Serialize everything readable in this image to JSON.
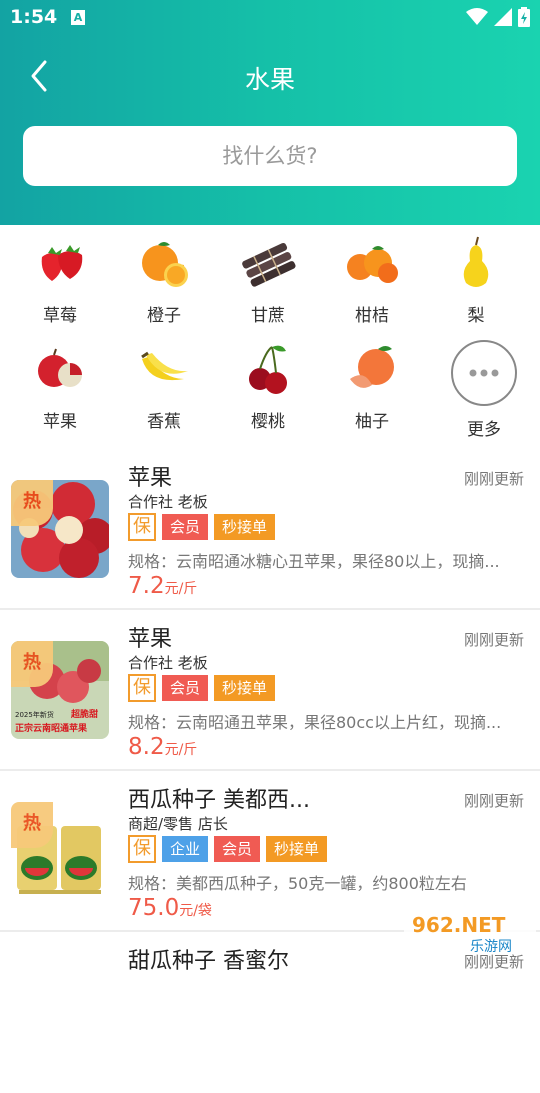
{
  "status": {
    "time": "1:54",
    "notif_letter": "A"
  },
  "header": {
    "title": "水果",
    "search_placeholder": "找什么货?"
  },
  "categories": [
    {
      "label": "草莓",
      "icon": "strawberry-icon"
    },
    {
      "label": "橙子",
      "icon": "orange-icon"
    },
    {
      "label": "甘蔗",
      "icon": "sugarcane-icon"
    },
    {
      "label": "柑桔",
      "icon": "tangerine-icon"
    },
    {
      "label": "梨",
      "icon": "pear-icon"
    },
    {
      "label": "苹果",
      "icon": "apple-icon"
    },
    {
      "label": "香蕉",
      "icon": "banana-icon"
    },
    {
      "label": "樱桃",
      "icon": "cherry-icon"
    },
    {
      "label": "柚子",
      "icon": "grapefruit-icon"
    },
    {
      "label": "更多",
      "icon": "more-icon"
    }
  ],
  "items": [
    {
      "title": "苹果",
      "time": "刚刚更新",
      "seller": "合作社 老板",
      "hot": "热",
      "tags": [
        "保",
        "会员",
        "秒接单"
      ],
      "spec": "规格：云南昭通冰糖心丑苹果，果径80以上，现摘...",
      "price": "7.2",
      "unit": "元/斤"
    },
    {
      "title": "苹果",
      "time": "刚刚更新",
      "seller": "合作社 老板",
      "hot": "热",
      "tags": [
        "保",
        "会员",
        "秒接单"
      ],
      "spec": "规格：云南昭通丑苹果，果径80cc以上片红，现摘...",
      "price": "8.2",
      "unit": "元/斤",
      "thumb_text_1": "2025年新货",
      "thumb_text_2": "超脆甜",
      "thumb_text_3": "正宗云南昭通苹果"
    },
    {
      "title": "西瓜种子 美都西...",
      "time": "刚刚更新",
      "seller": "商超/零售 店长",
      "hot": "热",
      "tags": [
        "保",
        "企业",
        "会员",
        "秒接单"
      ],
      "spec": "规格：美都西瓜种子，50克一罐，约800粒左右",
      "price": "75.0",
      "unit": "元/袋"
    },
    {
      "title": "甜瓜种子 香蜜尔",
      "time": "刚刚更新"
    }
  ],
  "watermark": {
    "logo": "962.NET",
    "text": "乐游网"
  },
  "colors": {
    "header_start": "#13a3a3",
    "header_end": "#1ad3b0",
    "price": "#ef5a48",
    "vip": "#f05b53",
    "fast": "#f39a24",
    "enterprise": "#4ea1e8"
  }
}
